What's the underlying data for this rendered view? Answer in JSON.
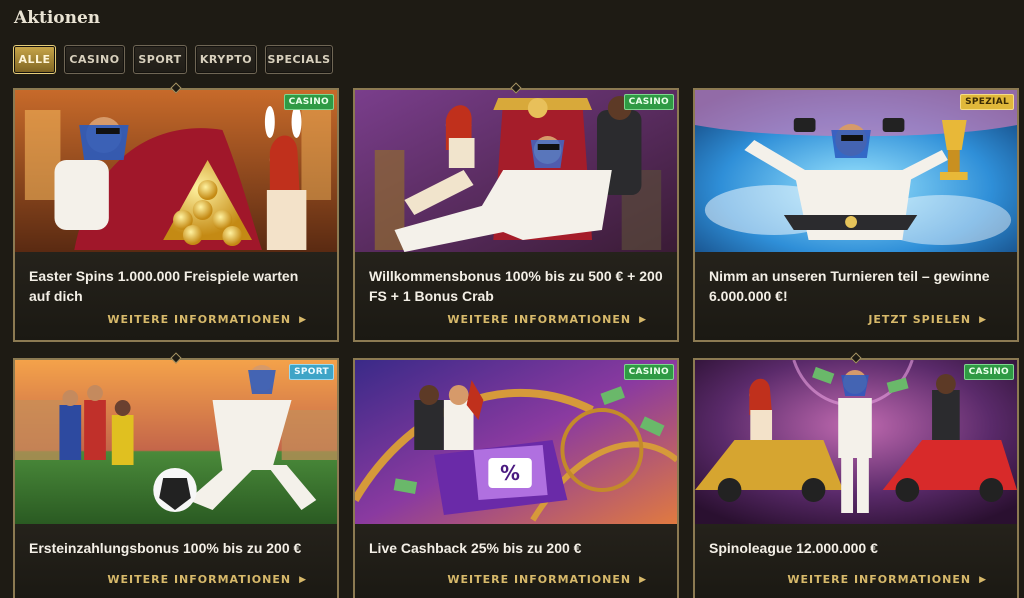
{
  "page": {
    "title": "Aktionen"
  },
  "filters": [
    {
      "label": "ALLE",
      "active": true
    },
    {
      "label": "CASINO",
      "active": false
    },
    {
      "label": "SPORT",
      "active": false
    },
    {
      "label": "KRYPTO",
      "active": false
    },
    {
      "label": "SPECIALS",
      "active": false
    }
  ],
  "promotions": [
    {
      "badge": "CASINO",
      "title": "Easter Spins 1.000.000 Freispiele warten auf dich",
      "cta": "WEITERE INFORMATIONEN"
    },
    {
      "badge": "CASINO",
      "title": "Willkommensbonus 100% bis zu 500 € + 200 FS + 1 Bonus Crab",
      "cta": "WEITERE INFORMATIONEN"
    },
    {
      "badge": "SPEZIAL",
      "title": "Nimm an unseren Turnieren teil – gewinne 6.000.000 €!",
      "cta": "JETZT SPIELEN"
    },
    {
      "badge": "SPORT",
      "title": "Ersteinzahlungsbonus 100% bis zu 200 €",
      "cta": "WEITERE INFORMATIONEN"
    },
    {
      "badge": "CASINO",
      "title": "Live Cashback 25% bis zu 200 €",
      "cta": "WEITERE INFORMATIONEN"
    },
    {
      "badge": "CASINO",
      "title": "Spinoleague 12.000.000 €",
      "cta": "WEITERE INFORMATIONEN"
    }
  ],
  "icons": {
    "cta_arrow": "triangle-right-icon",
    "cashback_symbol": "%"
  },
  "colors": {
    "accent": "#d7b96a",
    "casino_badge": "#2f9a44",
    "spezial_badge": "#e0b83a",
    "sport_badge": "#3ea4c7"
  }
}
